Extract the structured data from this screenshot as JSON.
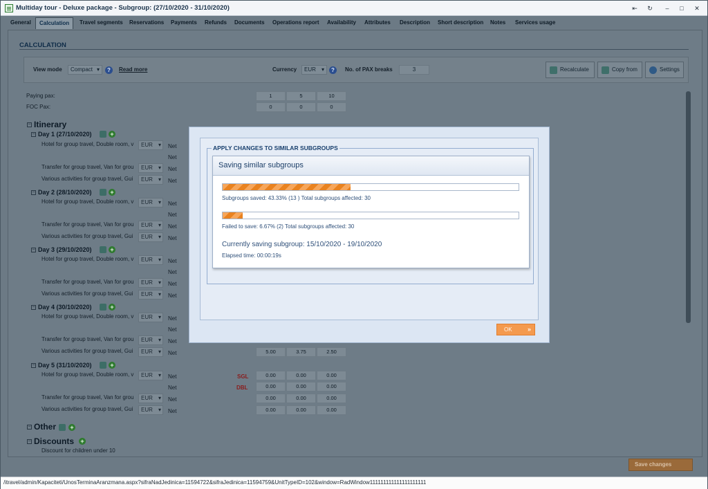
{
  "window": {
    "title": "Multiday tour - Deluxe package - Subgroup: (27/10/2020 - 31/10/2020)",
    "controls": [
      "⇤",
      "↻",
      "–",
      "□",
      "✕"
    ]
  },
  "tabs": [
    "General",
    "Calculation",
    "Travel segments",
    "Reservations",
    "Payments",
    "Refunds",
    "Documents",
    "Operations report",
    "Availability",
    "Attributes",
    "Description",
    "Short description",
    "Notes",
    "Services usage"
  ],
  "active_tab": "Calculation",
  "section_title": "CALCULATION",
  "toolbar": {
    "view_mode_label": "View mode",
    "view_mode_value": "Compact",
    "read_more": "Read more",
    "currency_label": "Currency",
    "currency_value": "EUR",
    "pax_breaks_label": "No. of PAX breaks",
    "pax_breaks_value": "3",
    "recalculate": "Recalculate",
    "copy_from": "Copy from",
    "settings": "Settings"
  },
  "pax": {
    "paying_label": "Paying pax:",
    "foc_label": "FOC Pax:",
    "paying": [
      "1",
      "5",
      "10"
    ],
    "foc": [
      "0",
      "0",
      "0"
    ]
  },
  "itinerary": {
    "title": "Itinerary",
    "days": [
      {
        "label": "Day 1 (27/10/2020)"
      },
      {
        "label": "Day 2 (28/10/2020)"
      },
      {
        "label": "Day 3 (29/10/2020)"
      },
      {
        "label": "Day 4 (30/10/2020)"
      },
      {
        "label": "Day 5 (31/10/2020)"
      }
    ],
    "service_hotel": "Hotel for group travel, Double room, v",
    "service_transfer": "Transfer for group travel, Van for grou",
    "service_activities": "Various activities for group travel, Gui",
    "currency": "EUR",
    "net": "Net",
    "day4_activities_values": [
      "5.00",
      "3.75",
      "2.50"
    ],
    "day5": {
      "sgl": "SGL",
      "dbl": "DBL",
      "sgl_values": [
        "0.00",
        "0.00",
        "0.00"
      ],
      "dbl_values": [
        "0.00",
        "0.00",
        "0.00"
      ],
      "transfer_values": [
        "0.00",
        "0.00",
        "0.00"
      ],
      "activities_values": [
        "0.00",
        "0.00",
        "0.00"
      ]
    }
  },
  "other_title": "Other",
  "discounts_title": "Discounts",
  "discount_row": "Discount for children under 10",
  "save_changes": "Save changes",
  "status_url": "/itravel/admin/Kapaciteti/UnosTerminaAranzmana.aspx?sifraNadJedinica=11594722&sifraJedinica=11594759&UnitTypeID=102&window=RadWindow111111111111111111111",
  "modal": {
    "legend": "APPLY CHANGES TO SIMILAR SUBGROUPS",
    "panel_title": "Saving similar subgroups",
    "saved_fraction": 0.4333,
    "saved_text": "Subgroups saved: 43.33% (13 ) Total subgroups affected: 30",
    "failed_fraction": 0.0667,
    "failed_text": "Failed to save: 6.67% (2) Total subgroups affected: 30",
    "current": "Currently saving subgroup: 15/10/2020 - 19/10/2020",
    "elapsed": "Elapsed time: 00:00:19s",
    "ok": "OK"
  }
}
